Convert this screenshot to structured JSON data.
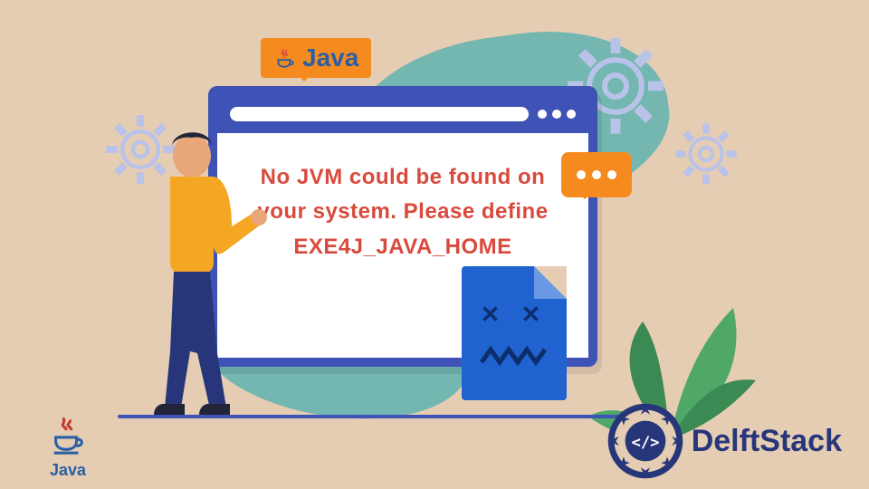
{
  "java_badge": {
    "label": "Java"
  },
  "error_message": "No JVM could be found on your system. Please define EXE4J_JAVA_HOME",
  "corner_java": {
    "label": "Java"
  },
  "delft": {
    "label": "DelftStack"
  },
  "icons": {
    "dead_eyes": "✕ ✕"
  }
}
